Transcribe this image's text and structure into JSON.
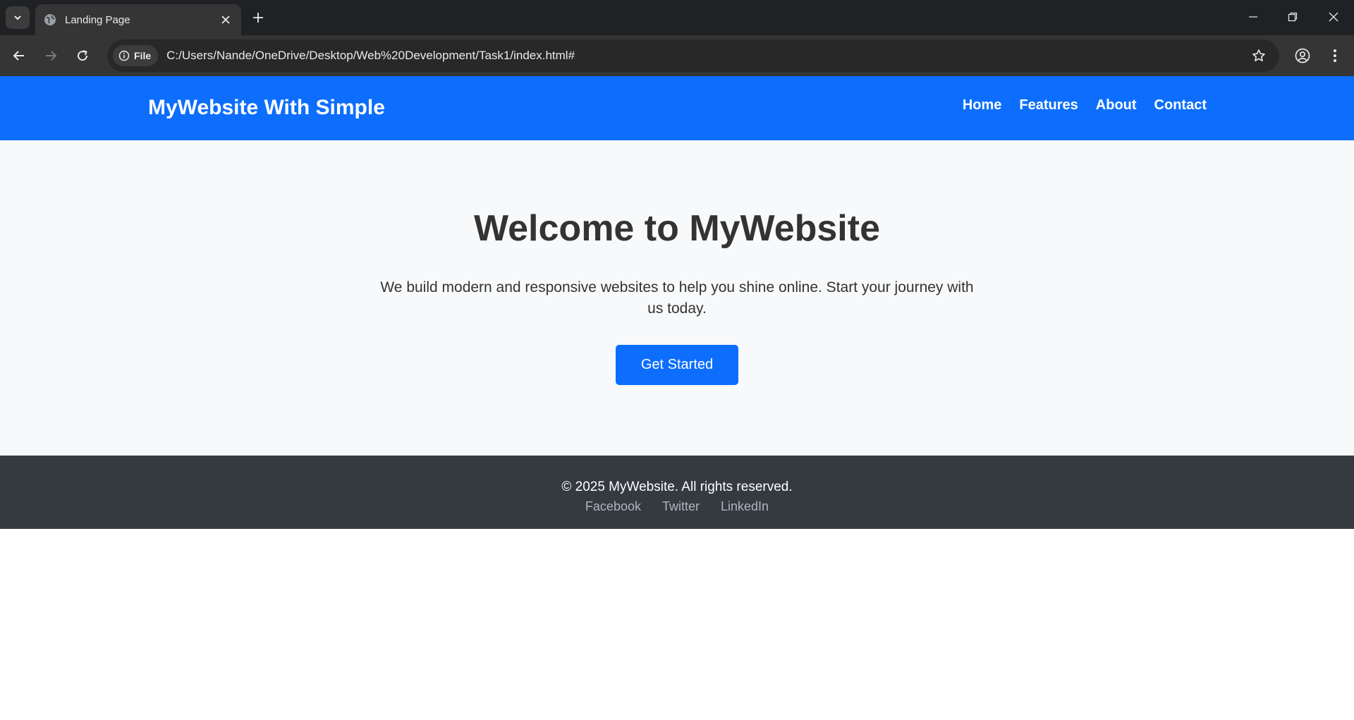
{
  "browser": {
    "tab": {
      "title": "Landing Page"
    },
    "address_bar": {
      "chip_label": "File",
      "url": "C:/Users/Nande/OneDrive/Desktop/Web%20Development/Task1/index.html#"
    },
    "icons": {
      "tab_search": "chevron-down-icon",
      "favicon": "globe-icon",
      "tab_close": "close-icon",
      "new_tab": "plus-icon",
      "back": "arrow-left-icon",
      "forward": "arrow-right-icon",
      "reload": "reload-icon",
      "info": "info-icon",
      "bookmark": "star-icon",
      "profile": "profile-icon",
      "menu": "kebab-menu-icon",
      "minimize": "minimize-icon",
      "restore": "restore-icon",
      "close_window": "close-icon"
    },
    "colors": {
      "tabbar": "#202124",
      "toolbar": "#353535",
      "omnibox": "#282828"
    }
  },
  "site": {
    "header": {
      "brand": "MyWebsite With Simple",
      "nav": [
        "Home",
        "Features",
        "About",
        "Contact"
      ],
      "color": "#0d6efd"
    },
    "hero": {
      "title": "Welcome to MyWebsite",
      "text": "We build modern and responsive websites to help you shine online. Start your journey with us today.",
      "cta": "Get Started",
      "background": "#f8f9fa"
    },
    "footer": {
      "copyright": "© 2025 MyWebsite. All rights reserved.",
      "links": [
        "Facebook",
        "Twitter",
        "LinkedIn"
      ],
      "background": "#343a40"
    }
  }
}
